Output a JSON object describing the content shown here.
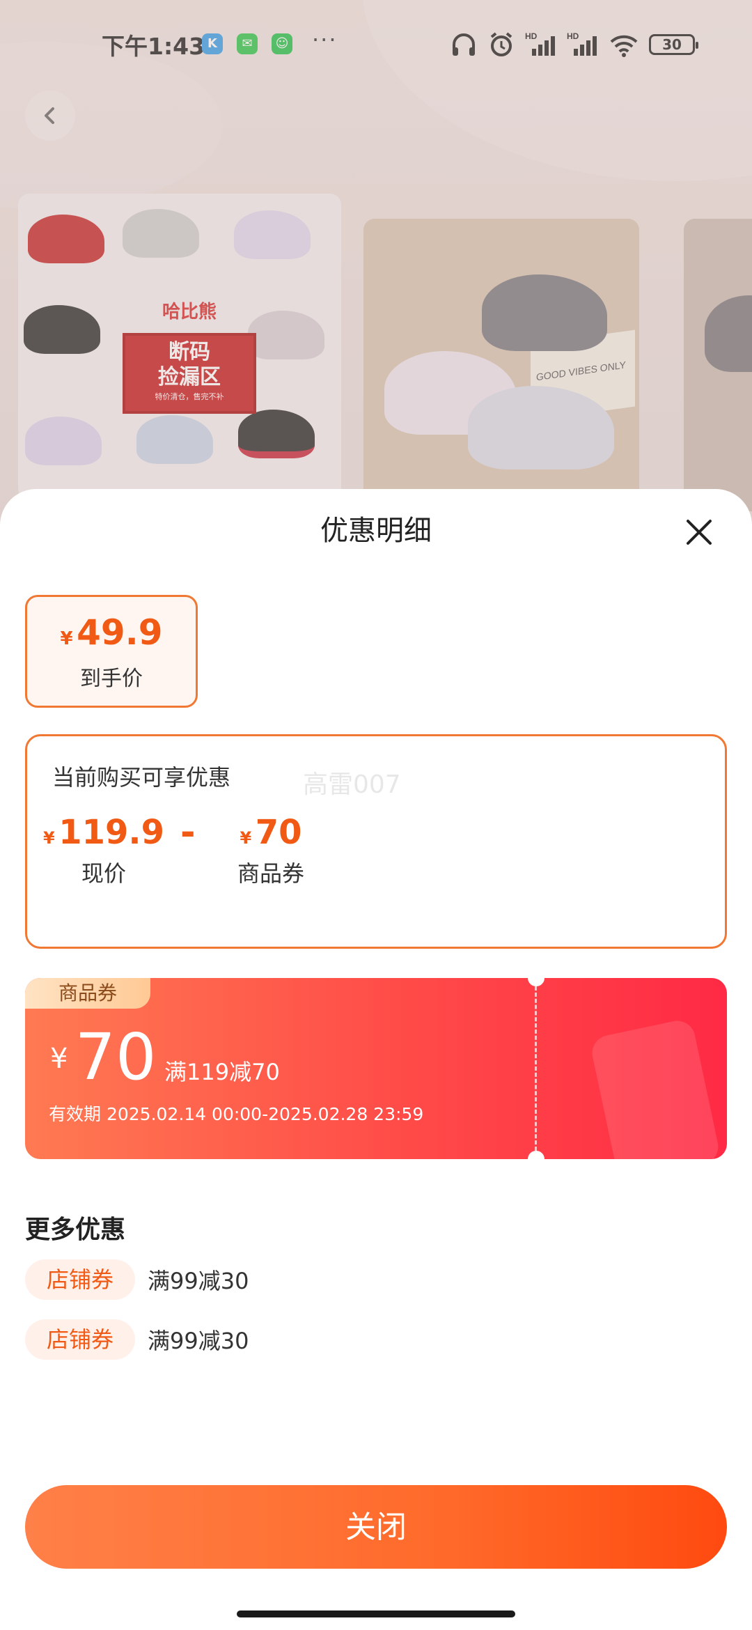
{
  "status_bar": {
    "time": "下午1:43",
    "battery": "30",
    "more": "···"
  },
  "background": {
    "brand_name": "哈比熊",
    "banner_line1": "断码",
    "banner_line2": "捡漏区",
    "banner_line3": "特价清仓，售完不补",
    "box_text": "GOOD VIBES ONLY"
  },
  "sheet": {
    "title": "优惠明细",
    "final_price": {
      "currency": "¥",
      "amount": "49.9",
      "label": "到手价"
    },
    "discount": {
      "title": "当前购买可享优惠",
      "watermark": "高雷007",
      "current": {
        "currency": "¥",
        "amount": "119.9",
        "label": "现价"
      },
      "operator": "-",
      "coupon": {
        "currency": "¥",
        "amount": "70",
        "label": "商品券"
      }
    },
    "coupon_card": {
      "tag": "商品券",
      "currency": "¥",
      "value": "70",
      "condition": "满119减70",
      "validity": "有效期 2025.02.14 00:00-2025.02.28 23:59"
    },
    "more": {
      "title": "更多优惠",
      "offers": [
        {
          "tag": "店铺券",
          "text": "满99减30"
        },
        {
          "tag": "店铺券",
          "text": "满99减30"
        }
      ]
    },
    "close_button": "关闭"
  },
  "colors": {
    "accent": "#f05a14",
    "coupon_start": "#ff7a52",
    "coupon_end": "#ff2a45"
  }
}
